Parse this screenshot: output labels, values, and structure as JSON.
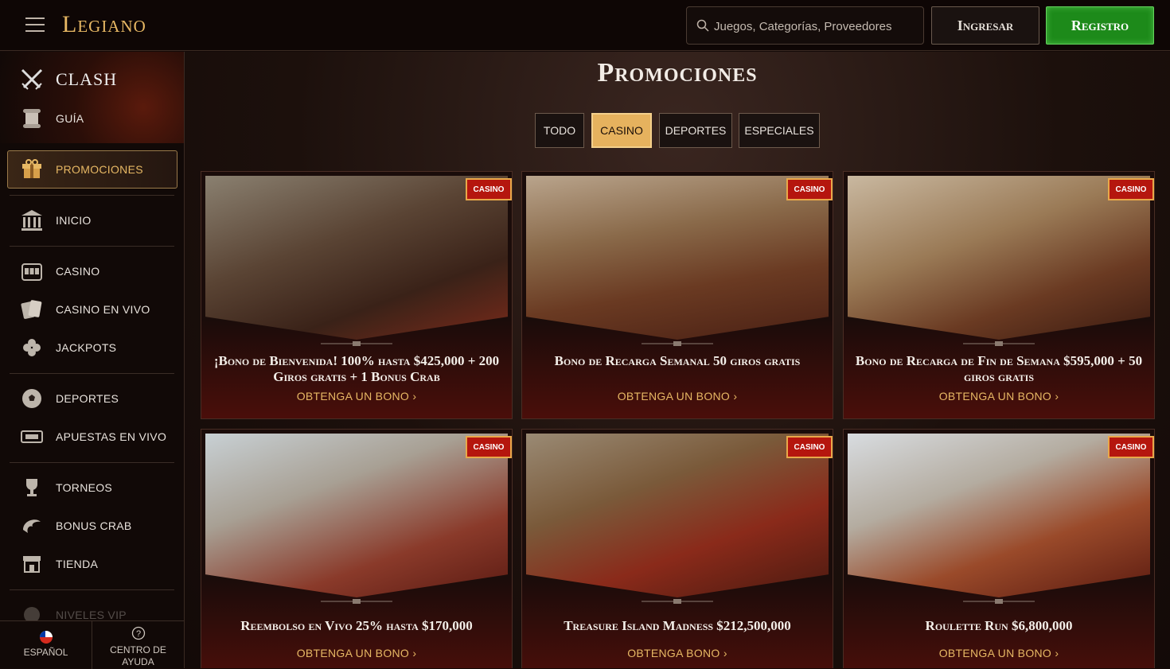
{
  "header": {
    "logo": "Legiano",
    "search_placeholder": "Juegos, Categorías, Proveedores",
    "login_label": "Ingresar",
    "register_label": "Registro"
  },
  "sidebar": {
    "items": [
      {
        "label": "CLASH",
        "icon": "crossed-swords-icon"
      },
      {
        "label": "GUÍA",
        "icon": "scroll-icon"
      },
      {
        "label": "PROMOCIONES",
        "icon": "gift-icon"
      },
      {
        "label": "INICIO",
        "icon": "temple-icon"
      },
      {
        "label": "CASINO",
        "icon": "slot-machine-icon"
      },
      {
        "label": "CASINO EN VIVO",
        "icon": "cards-icon"
      },
      {
        "label": "JACKPOTS",
        "icon": "clover-icon"
      },
      {
        "label": "DEPORTES",
        "icon": "soccer-ball-icon"
      },
      {
        "label": "APUESTAS EN VIVO",
        "icon": "live-tv-icon"
      },
      {
        "label": "TORNEOS",
        "icon": "trophy-icon"
      },
      {
        "label": "BONUS CRAB",
        "icon": "claw-icon"
      },
      {
        "label": "TIENDA",
        "icon": "shop-icon"
      },
      {
        "label": "NIVELES VIP",
        "icon": "vip-icon"
      }
    ],
    "language": "ESPAÑOL",
    "help": "CENTRO DE AYUDA"
  },
  "main": {
    "title": "Promociones",
    "filters": [
      "TODO",
      "CASINO",
      "DEPORTES",
      "ESPECIALES"
    ],
    "active_filter": "CASINO",
    "cards": [
      {
        "tag": "CASINO",
        "title": "¡Bono de Bienvenida! 100% hasta $425,000 + 200 Giros gratis + 1 Bonus Crab",
        "cta": "OBTENGA UN BONO"
      },
      {
        "tag": "CASINO",
        "title": "Bono de Recarga Semanal 50 giros gratis",
        "cta": "OBTENGA UN BONO"
      },
      {
        "tag": "CASINO",
        "title": "Bono de Recarga de Fin de Semana $595,000 + 50 giros gratis",
        "cta": "OBTENGA UN BONO"
      },
      {
        "tag": "CASINO",
        "title": "Reembolso en Vivo 25% hasta $170,000",
        "cta": "OBTENGA UN BONO"
      },
      {
        "tag": "CASINO",
        "title": "Treasure Island Madness $212,500,000",
        "cta": "OBTENGA BONO"
      },
      {
        "tag": "CASINO",
        "title": "Roulette Run $6,800,000",
        "cta": "OBTENGA UN BONO"
      }
    ]
  },
  "colors": {
    "accent_gold": "#e7b864",
    "register_green": "#1d8a1a",
    "tag_red": "#b5160e"
  }
}
